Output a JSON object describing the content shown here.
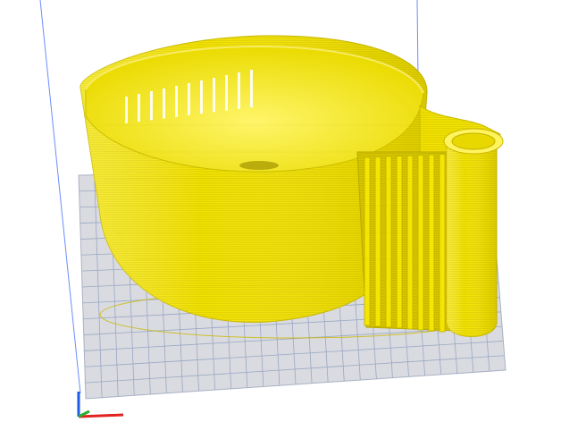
{
  "viewport": {
    "background_color": "#ffffff",
    "build_plate_color": "#dcdcdc",
    "grid_color": "#9aa7c4",
    "model_color": "#f2e400",
    "model_shadow_color": "#d1c100",
    "model_highlight_color": "#fff98a",
    "axes": [
      {
        "name": "x-axis",
        "color": "#e32222"
      },
      {
        "name": "y-axis",
        "color": "#2bb02b"
      },
      {
        "name": "z-axis",
        "color": "#1e5be6"
      }
    ]
  }
}
